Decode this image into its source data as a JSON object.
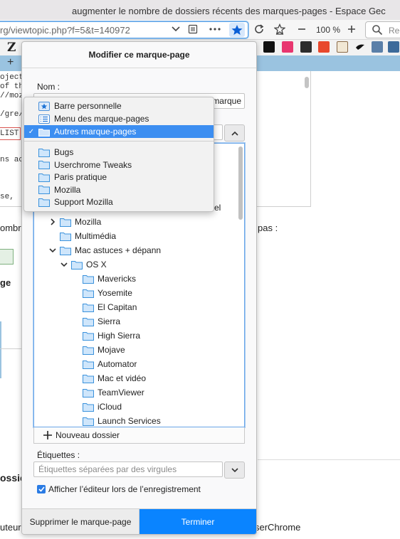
{
  "window": {
    "title": "augmenter le nombre de dossiers récents des marques-pages - Espace Gec"
  },
  "navbar": {
    "url": "rg/viewtopic.php?f=5&t=140972",
    "zoom": "100 %",
    "search_placeholder": "Rec"
  },
  "page_behind": {
    "code_lines": [
      "oject",
      "of th",
      "//moz",
      "/gre/",
      "ns ac",
      "se,"
    ],
    "filter_text": "LIST",
    "left_text": [
      "ombr",
      "ge",
      "ossie",
      "uteur"
    ],
    "right_text": [
      "pas :",
      "serChrome"
    ]
  },
  "panel": {
    "title": "Modifier ce marque-page",
    "name_label": "Nom :",
    "name_value": "marque",
    "tags_label": "Étiquettes :",
    "tags_placeholder": "Étiquettes séparées par des virgules",
    "show_editor_label": "Afficher l’éditeur lors de l’enregistrement",
    "show_editor_checked": true,
    "new_folder_label": "Nouveau dossier",
    "remove_label": "Supprimer le marque-page",
    "done_label": "Terminer",
    "accent_color": "#0a84ff"
  },
  "folder_menu": {
    "items": [
      {
        "label": "Barre personnelle",
        "icon": "star-folder-icon"
      },
      {
        "label": "Menu des marque-pages",
        "icon": "menu-list-icon"
      },
      {
        "label": "Autres marque-pages",
        "icon": "other-bookmarks-icon",
        "selected": true
      }
    ],
    "recent": [
      "Bugs",
      "Userchrome Tweaks",
      "Paris pratique",
      "Mozilla",
      "Support Mozilla"
    ]
  },
  "tree": {
    "partial_row_text": "el",
    "rows": [
      {
        "label": "Mozilla",
        "depth": 1,
        "twisty": "collapsed"
      },
      {
        "label": "Multimédia",
        "depth": 1,
        "twisty": "none"
      },
      {
        "label": "Mac astuces + dépann",
        "depth": 1,
        "twisty": "expanded"
      },
      {
        "label": "OS X",
        "depth": 2,
        "twisty": "expanded"
      },
      {
        "label": "Mavericks",
        "depth": 3,
        "twisty": "none"
      },
      {
        "label": "Yosemite",
        "depth": 3,
        "twisty": "none"
      },
      {
        "label": "El Capitan",
        "depth": 3,
        "twisty": "none"
      },
      {
        "label": "Sierra",
        "depth": 3,
        "twisty": "none"
      },
      {
        "label": "High Sierra",
        "depth": 3,
        "twisty": "none"
      },
      {
        "label": "Mojave",
        "depth": 3,
        "twisty": "none"
      },
      {
        "label": "Automator",
        "depth": 3,
        "twisty": "none"
      },
      {
        "label": "Mac et vidéo",
        "depth": 3,
        "twisty": "none"
      },
      {
        "label": "TeamViewer",
        "depth": 3,
        "twisty": "none"
      },
      {
        "label": "iCloud",
        "depth": 3,
        "twisty": "none"
      },
      {
        "label": "Launch Services",
        "depth": 3,
        "twisty": "none"
      }
    ]
  }
}
